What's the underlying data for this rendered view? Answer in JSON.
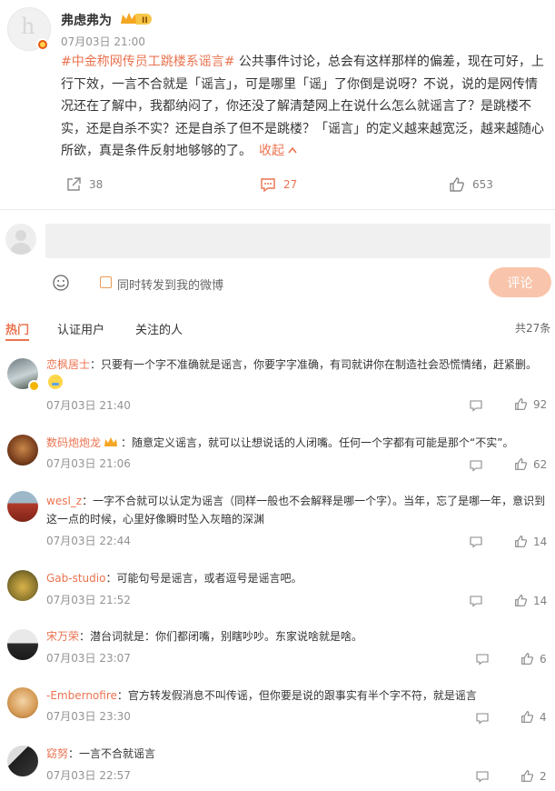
{
  "post": {
    "author": "弗虑弗为",
    "crown_badge": "II",
    "time": "07月03日 21:00",
    "hashtag": "#中金称网传员工跳楼系谣言#",
    "body": " 公共事件讨论，总会有这样那样的偏差，现在可好，上行下效，一言不合就是「谣言」，可是哪里「谣」了你倒是说呀？不说，说的是网传情况还在了解中，我都纳闷了，你还没了解清楚网上在说什么怎么就谣言了？是跳楼不实，还是自杀不实？还是自杀了但不是跳楼？「谣言」的定义越来越宽泛，越来越随心所欲，真是条件反射地够够的了。",
    "collapse_label": "收起",
    "repost_count": "38",
    "comment_count": "27",
    "like_count": "653"
  },
  "composer": {
    "input_value": "",
    "forward_label": "同时转发到我的微博",
    "submit_label": "评论"
  },
  "tabs": [
    {
      "label": "热门"
    },
    {
      "label": "认证用户"
    },
    {
      "label": "关注的人"
    }
  ],
  "total_label": "共27条",
  "comments": [
    {
      "user": "恋枫居士",
      "text": "：只要有一个字不准确就是谣言，你要字字准确，有司就讲你在制造社会恐慌情绪，赶紧删。",
      "time": "07月03日 21:40",
      "likes": "92"
    },
    {
      "user": "数码炮炮龙",
      "text": "：随意定义谣言，就可以让想说话的人闭嘴。任何一个字都有可能是那个“不实”。",
      "time": "07月03日 21:06",
      "likes": "62"
    },
    {
      "user": "wesl_z",
      "text": "：一字不合就可以认定为谣言（同样一般也不会解释是哪一个字）。当年，忘了是哪一年，意识到这一点的时候，心里好像瞬时坠入灰暗的深渊",
      "time": "07月03日 22:44",
      "likes": "14"
    },
    {
      "user": "Gab-studio",
      "text": "：可能句号是谣言，或者逗号是谣言吧。",
      "time": "07月03日 21:52",
      "likes": "14"
    },
    {
      "user": "宋万荣",
      "text": "：潜台词就是：你们都闭嘴，别瞎吵吵。东家说啥就是啥。",
      "time": "07月03日 23:07",
      "likes": "6"
    },
    {
      "user": "-Embernofire",
      "text": "：官方转发假消息不叫传谣，但你要是说的跟事实有半个字不符，就是谣言",
      "time": "07月03日 23:30",
      "likes": "4"
    },
    {
      "user": "窈努",
      "text": "：一言不合就谣言",
      "time": "07月03日 22:57",
      "likes": "2"
    }
  ],
  "colors": {
    "accent": "#eb7350",
    "muted": "#939393",
    "submit_bg": "#f8c5ac"
  }
}
